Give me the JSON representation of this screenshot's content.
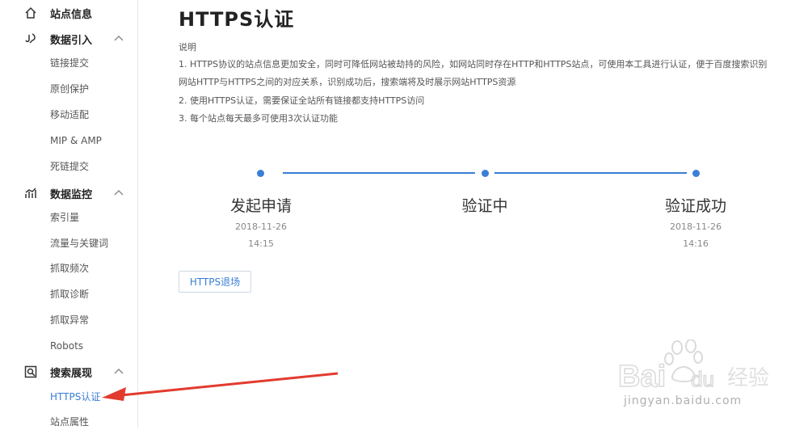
{
  "sidebar": {
    "groups": [
      {
        "icon": "home-icon",
        "label": "站点信息",
        "expanded": false
      },
      {
        "icon": "data-import-icon",
        "label": "数据引入",
        "expanded": true,
        "items": [
          "链接提交",
          "原创保护",
          "移动适配",
          "MIP & AMP",
          "死链提交"
        ]
      },
      {
        "icon": "data-monitor-icon",
        "label": "数据监控",
        "expanded": true,
        "items": [
          "索引量",
          "流量与关键词",
          "抓取频次",
          "抓取诊断",
          "抓取异常",
          "Robots"
        ]
      },
      {
        "icon": "search-display-icon",
        "label": "搜索展现",
        "expanded": true,
        "items": [
          "HTTPS认证",
          "站点属性"
        ],
        "active_item": "HTTPS认证"
      }
    ]
  },
  "main": {
    "title": "HTTPS认证",
    "description": [
      "说明",
      "1. HTTPS协议的站点信息更加安全，同时可降低网站被劫持的风险，如网站同时存在HTTP和HTTPS站点，可使用本工具进行认证，便于百度搜索识别",
      "网站HTTP与HTTPS之间的对应关系，识别成功后，搜索端将及时展示网站HTTPS资源",
      "2. 使用HTTPS认证，需要保证全站所有链接都支持HTTPS访问",
      "3. 每个站点每天最多可使用3次认证功能"
    ],
    "steps": [
      {
        "title": "发起申请",
        "date": "2018-11-26",
        "time": "14:15"
      },
      {
        "title": "验证中",
        "date": "",
        "time": ""
      },
      {
        "title": "验证成功",
        "date": "2018-11-26",
        "time": "14:16"
      }
    ],
    "exit_button": "HTTPS退场"
  },
  "watermark": {
    "brand": "Bai du 经验",
    "url": "jingyan.baidu.com"
  },
  "colors": {
    "accent": "#3a7fd6",
    "arrow": "#e23b2e"
  }
}
